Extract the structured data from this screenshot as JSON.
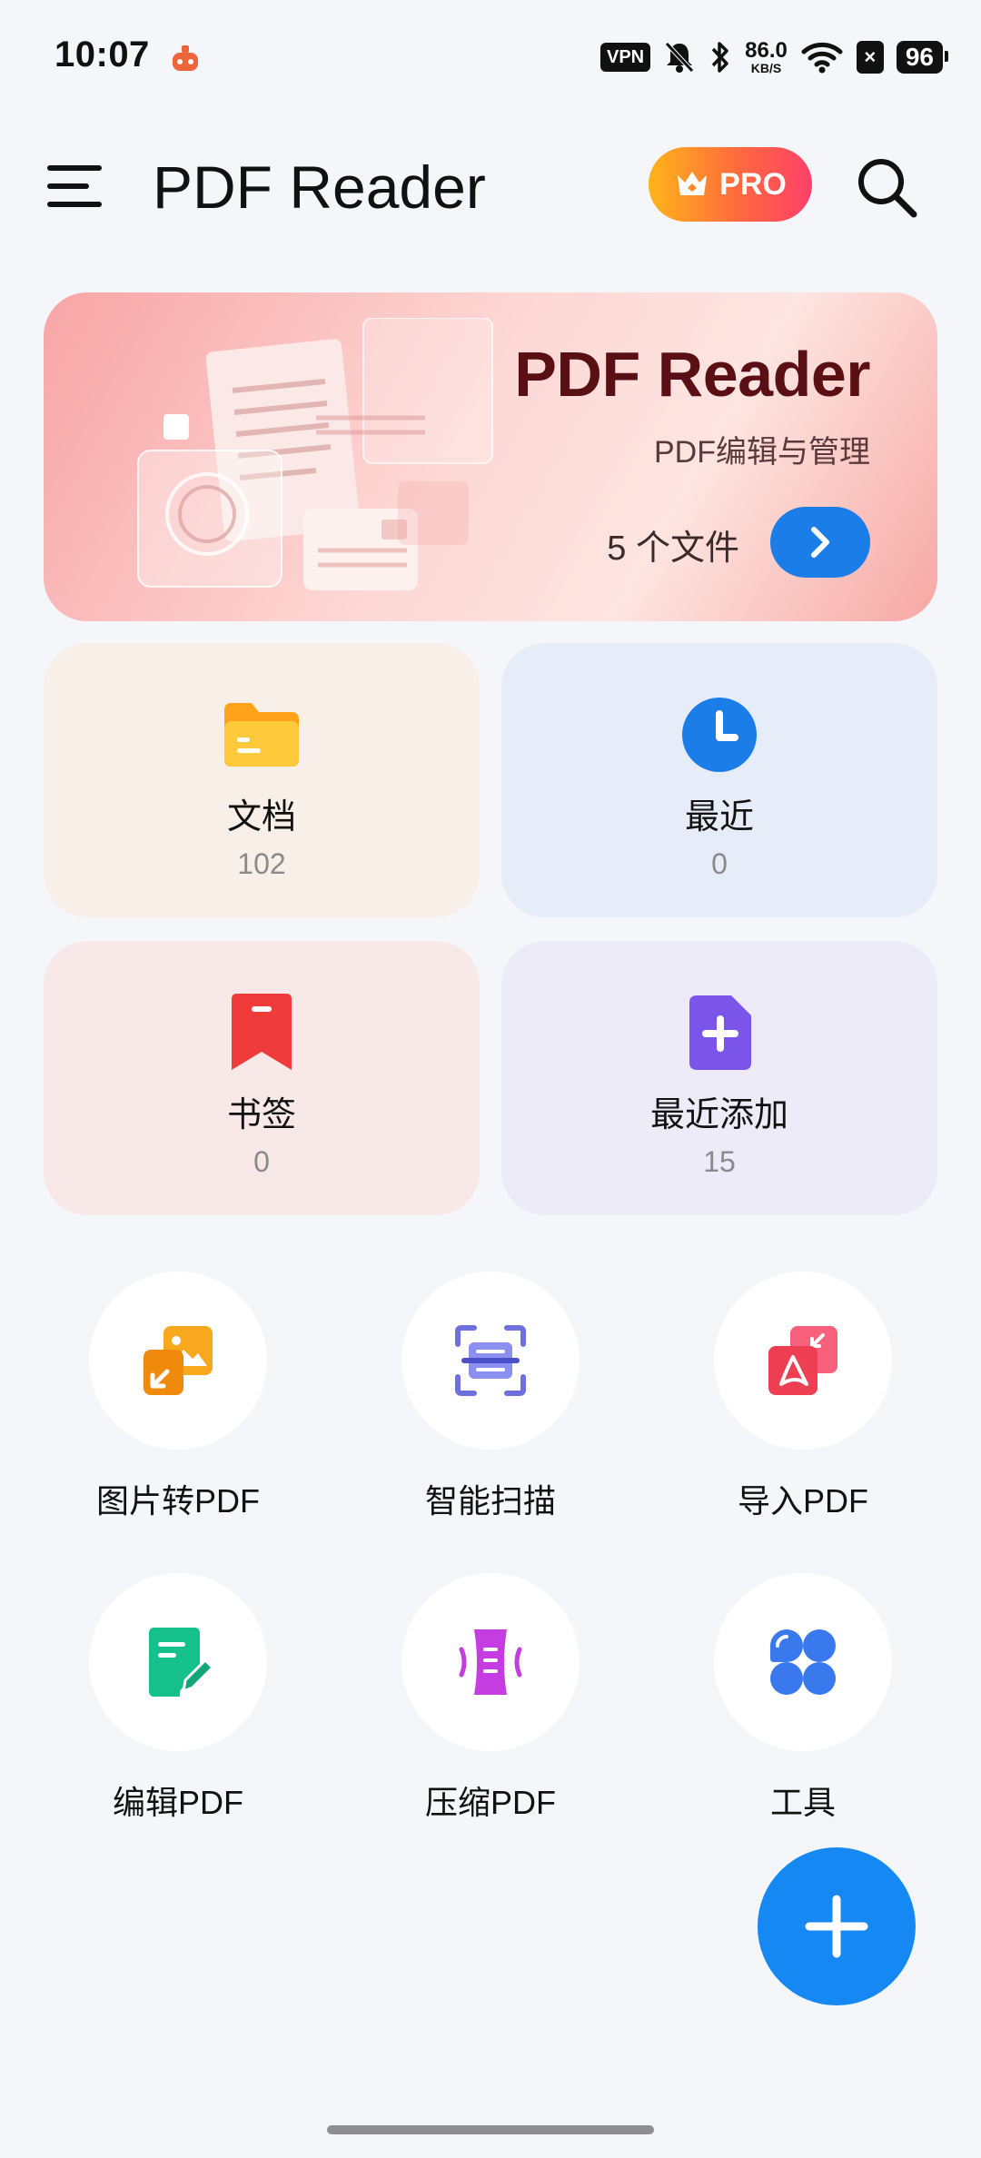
{
  "status_bar": {
    "time": "10:07",
    "vpn": "VPN",
    "speed_value": "86.0",
    "speed_unit": "KB/S",
    "battery": "96",
    "icons": [
      "app-notification-icon",
      "vpn-icon",
      "mute-bell-icon",
      "bluetooth-icon",
      "network-speed",
      "wifi-icon",
      "x-badge-icon",
      "battery-icon"
    ]
  },
  "app_bar": {
    "title": "PDF Reader",
    "pro_label": "PRO",
    "icons": [
      "menu-icon",
      "crown-icon",
      "search-icon"
    ]
  },
  "banner": {
    "title": "PDF Reader",
    "subtitle": "PDF编辑与管理",
    "file_count": "5 个文件",
    "icons": [
      "chevron-right-icon"
    ]
  },
  "categories": [
    {
      "label": "文档",
      "count": "102",
      "icon": "folder-icon",
      "color": "#fbb02a"
    },
    {
      "label": "最近",
      "count": "0",
      "icon": "clock-icon",
      "color": "#1a7de8"
    },
    {
      "label": "书签",
      "count": "0",
      "icon": "bookmark-icon",
      "color": "#ef3b3b"
    },
    {
      "label": "最近添加",
      "count": "15",
      "icon": "add-file-icon",
      "color": "#7b55ea"
    }
  ],
  "tools": [
    {
      "label": "图片转PDF",
      "icon": "image-to-pdf-icon",
      "color": "#f59a14"
    },
    {
      "label": "智能扫描",
      "icon": "scan-icon",
      "color": "#6c6fdc"
    },
    {
      "label": "导入PDF",
      "icon": "import-pdf-icon",
      "color": "#ee3f52"
    },
    {
      "label": "编辑PDF",
      "icon": "edit-pdf-icon",
      "color": "#16c08a"
    },
    {
      "label": "压缩PDF",
      "icon": "compress-pdf-icon",
      "color": "#c53ce0"
    },
    {
      "label": "工具",
      "icon": "tools-grid-icon",
      "color": "#3a78ee"
    }
  ],
  "fab": {
    "icon": "plus-icon",
    "color": "#1588f4"
  }
}
